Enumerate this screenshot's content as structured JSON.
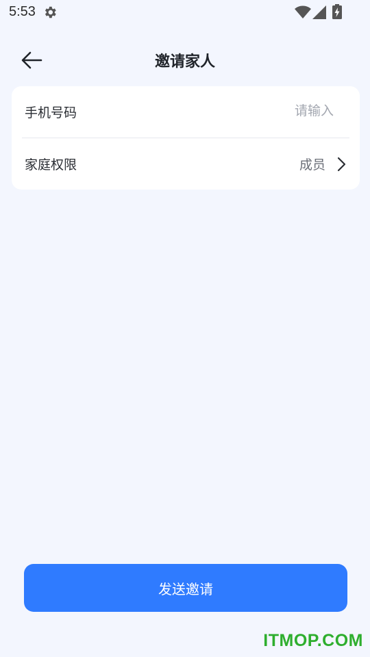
{
  "status_bar": {
    "time": "5:53",
    "icons": [
      "gear-icon",
      "wifi-icon",
      "signal-icon",
      "battery-icon"
    ]
  },
  "header": {
    "back_icon": "arrow-left-icon",
    "title": "邀请家人"
  },
  "form": {
    "phone": {
      "label": "手机号码",
      "value": "",
      "placeholder": "请输入"
    },
    "role": {
      "label": "家庭权限",
      "value": "成员",
      "icon": "chevron-right-icon"
    }
  },
  "actions": {
    "send_label": "发送邀请"
  },
  "watermark": "ITMOP.COM",
  "colors": {
    "background": "#f3f6fe",
    "card": "#ffffff",
    "primary": "#2f7bff",
    "placeholder": "#a3a7b0",
    "watermark": "#2eae2e"
  }
}
